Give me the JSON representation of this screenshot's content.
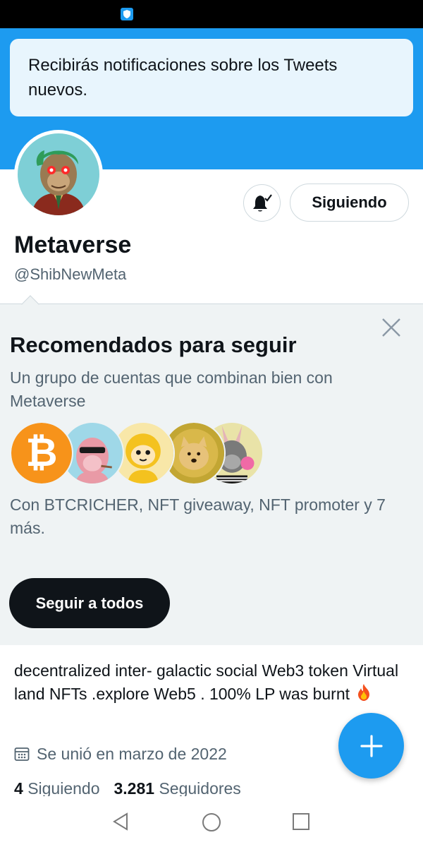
{
  "status_bar": {
    "icon": "shield-icon"
  },
  "toast": {
    "message": "Recibirás notificaciones sobre los Tweets nuevos."
  },
  "profile": {
    "display_name": "Metaverse",
    "handle": "@ShibNewMeta",
    "following_button_label": "Siguiendo",
    "notification_icon": "bell-check-icon",
    "bio": "decentralized inter- galactic social Web3 token Virtual land NFTs .explore Web5 . 100% LP was burnt",
    "bio_emoji": "fire-icon",
    "joined": "Se unió en marzo de 2022",
    "following_count": "4",
    "following_label": "Siguiendo",
    "followers_count": "3.281",
    "followers_label": "Seguidores"
  },
  "recommendations": {
    "title": "Recomendados para seguir",
    "subtitle": "Un grupo de cuentas que combinan bien con Metaverse",
    "with_text": "Con BTCRICHER, NFT giveaway, NFT promoter y 7 más.",
    "follow_all_label": "Seguir a todos",
    "avatars": [
      "bitcoin-logo",
      "pink-ape-avatar",
      "cartoon-monkey-avatar",
      "dogecoin-logo",
      "bunny-ape-avatar"
    ]
  },
  "fab": {
    "icon": "plus-icon"
  },
  "nav": {
    "back": "back-icon",
    "home": "home-icon",
    "recents": "recents-icon"
  },
  "colors": {
    "accent": "#1d9bf0",
    "text_primary": "#0f1419",
    "text_secondary": "#536471",
    "reco_background": "#eff3f4",
    "toast_background": "#e8f5fd"
  }
}
